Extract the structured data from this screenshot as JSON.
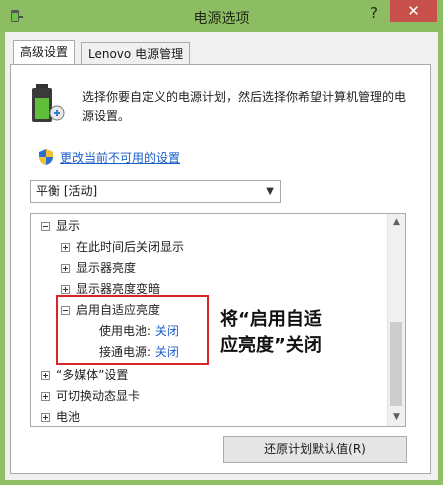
{
  "window": {
    "title": "电源选项",
    "help": "?",
    "close": "✕"
  },
  "tabs": [
    {
      "label": "高级设置",
      "active": true
    },
    {
      "label": "Lenovo 电源管理",
      "active": false
    }
  ],
  "description": "选择你要自定义的电源计划，然后选择你希望计算机管理的电源设置。",
  "change_link": "更改当前不可用的设置",
  "plan_select": {
    "value": "平衡 [活动]"
  },
  "tree": {
    "items": [
      {
        "label": "显示",
        "expanded": true,
        "level": 0
      },
      {
        "label": "在此时间后关闭显示",
        "expanded": false,
        "level": 1
      },
      {
        "label": "显示器亮度",
        "expanded": false,
        "level": 1
      },
      {
        "label": "显示器亮度变暗",
        "expanded": false,
        "level": 1
      },
      {
        "label": "启用自适应亮度",
        "expanded": true,
        "level": 1
      },
      {
        "label": "使用电池:",
        "value": "关闭",
        "level": 2
      },
      {
        "label": "接通电源:",
        "value": "关闭",
        "level": 2
      },
      {
        "label": "“多媒体”设置",
        "expanded": false,
        "level": 0
      },
      {
        "label": "可切换动态显卡",
        "expanded": false,
        "level": 0
      },
      {
        "label": "电池",
        "expanded": false,
        "level": 0
      }
    ]
  },
  "annotation": {
    "line1": "将“启用自适",
    "line2": "应亮度”关闭"
  },
  "restore_button": "还原计划默认值(R)",
  "colors": {
    "accent": "#8dbd63",
    "close": "#c7504a",
    "link": "#1a5ec9",
    "highlight": "#d9252a"
  }
}
